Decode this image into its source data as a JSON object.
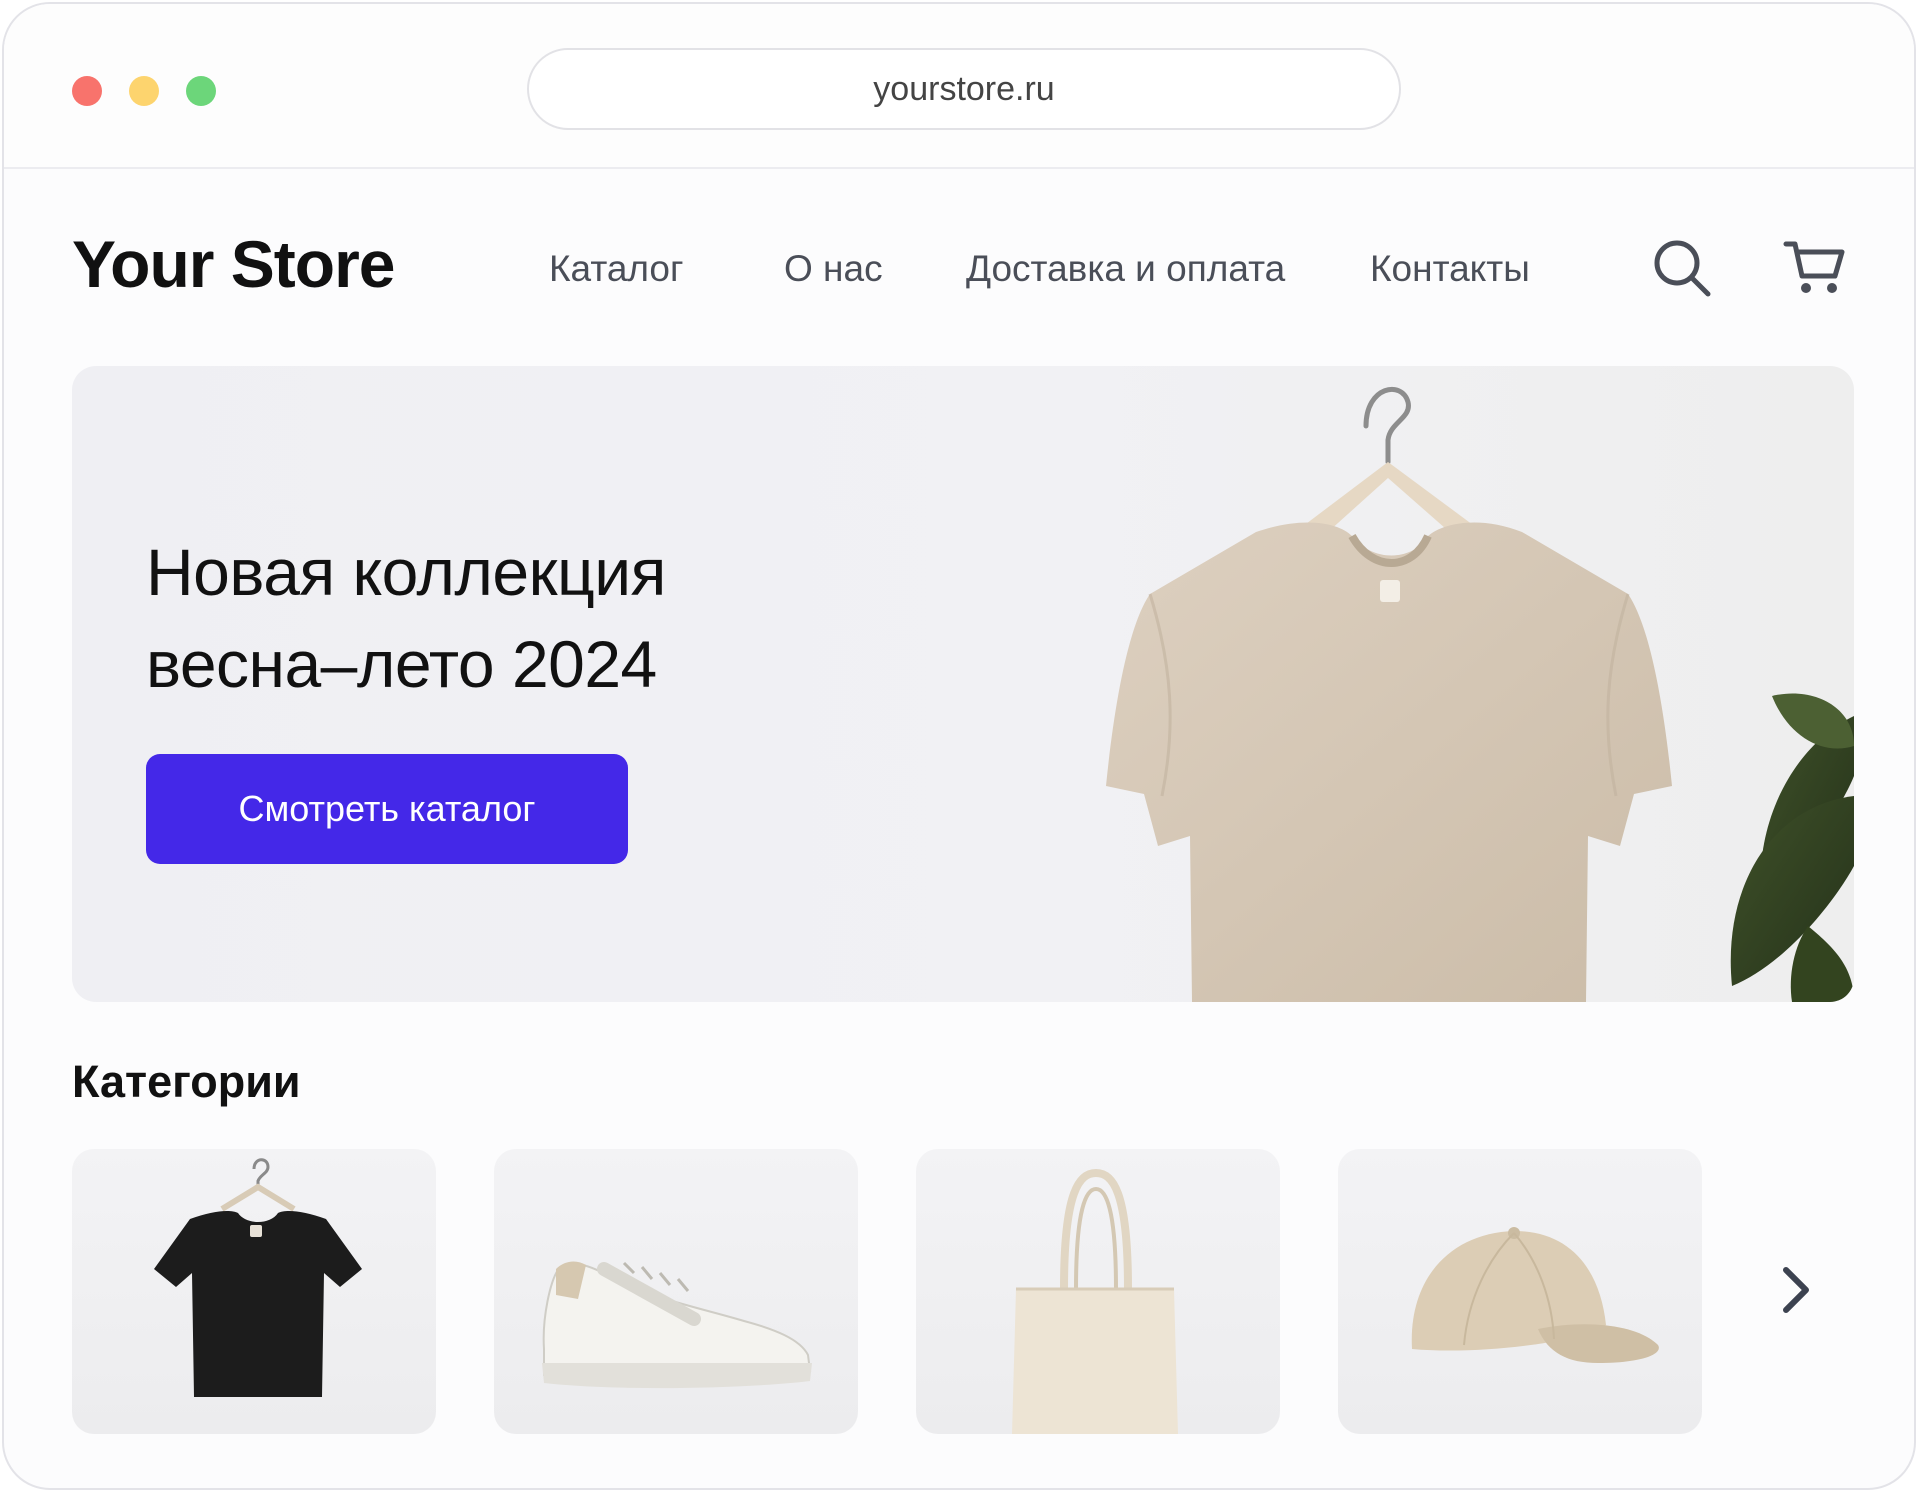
{
  "browser": {
    "url": "yourstore.ru",
    "traffic_lights": {
      "close": "#f8736c",
      "minimize": "#fdd46e",
      "maximize": "#6cd67a"
    }
  },
  "header": {
    "logo": "Your Store",
    "nav": [
      "Каталог",
      "О нас",
      "Доставка и оплата",
      "Контакты"
    ],
    "icons": [
      "search-icon",
      "cart-icon"
    ]
  },
  "hero": {
    "title_line1": "Новая коллекция",
    "title_line2": "весна–лето 2024",
    "cta_label": "Смотреть каталог",
    "accent_color": "#4428e8",
    "image": "beige t-shirt on wooden hanger with plant"
  },
  "categories": {
    "title": "Категории",
    "items": [
      {
        "image": "black t-shirt on hanger"
      },
      {
        "image": "white sneaker"
      },
      {
        "image": "canvas tote bag"
      },
      {
        "image": "beige baseball cap"
      }
    ],
    "next_icon": "chevron-right-icon"
  }
}
